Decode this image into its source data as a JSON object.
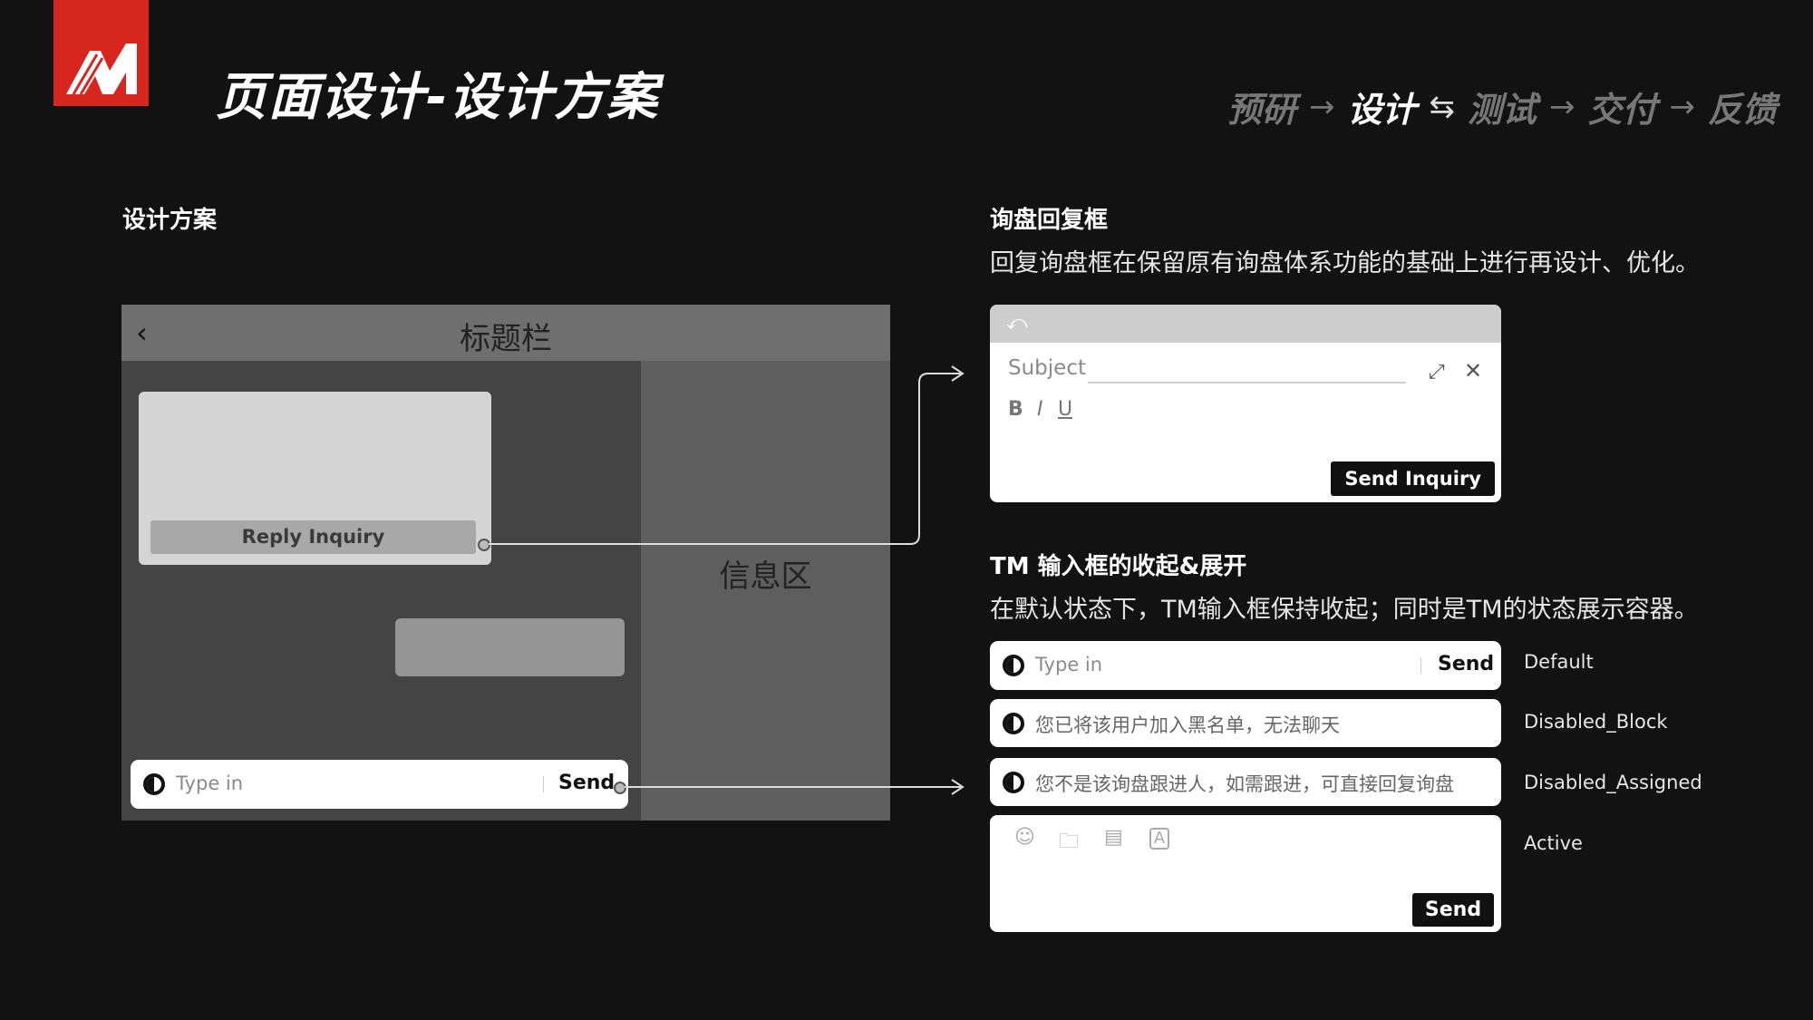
{
  "header": {
    "logo_letter": "M",
    "title": "页面设计-设计方案",
    "process": [
      {
        "label": "预研",
        "current": false
      },
      {
        "arrow": "→"
      },
      {
        "label": "设计",
        "current": true
      },
      {
        "arrow": "⇆"
      },
      {
        "label": "测试",
        "current": false
      },
      {
        "arrow": "→"
      },
      {
        "label": "交付",
        "current": false
      },
      {
        "arrow": "→"
      },
      {
        "label": "反馈",
        "current": false
      }
    ]
  },
  "left_section": {
    "heading": "设计方案",
    "mockup": {
      "title_bar": "标题栏",
      "back_icon": "chevron-left-icon",
      "reply_button": "Reply Inquiry",
      "info_area": "信息区",
      "input_placeholder": "Type in",
      "send_label": "Send"
    }
  },
  "reply_section": {
    "heading": "询盘回复框",
    "description": "回复询盘框在保留原有询盘体系功能的基础上进行再设计、优化。",
    "box": {
      "subject_placeholder": "Subject",
      "bold": "B",
      "italic": "I",
      "underline": "U",
      "send_button": "Send Inquiry"
    }
  },
  "tm_section": {
    "heading": "TM 输入框的收起&展开",
    "description": "在默认状态下，TM输入框保持收起；同时是TM的状态展示容器。",
    "states": [
      {
        "label": "Default",
        "text": "Type in",
        "send": "Send"
      },
      {
        "label": "Disabled_Block",
        "text": "您已将该用户加入黑名单，无法聊天"
      },
      {
        "label": "Disabled_Assigned",
        "text": "您不是该询盘跟进人，如需跟进，可直接回复询盘"
      },
      {
        "label": "Active",
        "send": "Send",
        "tools": [
          "emoji-icon",
          "folder-icon",
          "quick-reply-icon",
          "translate-icon"
        ]
      }
    ]
  },
  "colors": {
    "brand": "#d7261e",
    "background": "#121212"
  }
}
